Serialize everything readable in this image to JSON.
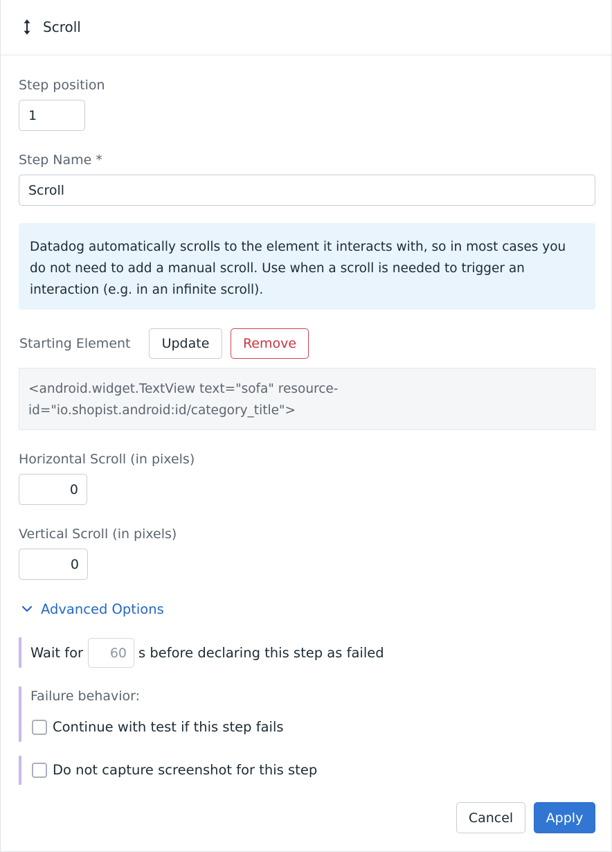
{
  "header": {
    "title": "Scroll",
    "icon": "scroll-vertical-icon"
  },
  "step_position": {
    "label": "Step position",
    "value": "1"
  },
  "step_name": {
    "label": "Step Name *",
    "value": "Scroll"
  },
  "info_text": "Datadog automatically scrolls to the element it interacts with, so in most cases you do not need to add a manual scroll. Use when a scroll is needed to trigger an interaction (e.g. in an infinite scroll).",
  "starting_element": {
    "label": "Starting Element",
    "update_label": "Update",
    "remove_label": "Remove",
    "code": "<android.widget.TextView text=\"sofa\" resource-id=\"io.shopist.android:id/category_title\">"
  },
  "horizontal_scroll": {
    "label": "Horizontal Scroll (in pixels)",
    "value": "0"
  },
  "vertical_scroll": {
    "label": "Vertical Scroll (in pixels)",
    "value": "0"
  },
  "advanced": {
    "label": "Advanced Options",
    "wait_prefix": "Wait for",
    "wait_value": "60",
    "wait_suffix": "s before declaring this step as failed",
    "failure_label": "Failure behavior:",
    "continue_label": "Continue with test if this step fails",
    "screenshot_label": "Do not capture screenshot for this step"
  },
  "footer": {
    "cancel_label": "Cancel",
    "apply_label": "Apply"
  },
  "colors": {
    "accent": "#3176d3",
    "link": "#2368c4",
    "danger": "#c93540",
    "info_bg": "#e9f4fc",
    "bar": "#c9b8f0"
  }
}
